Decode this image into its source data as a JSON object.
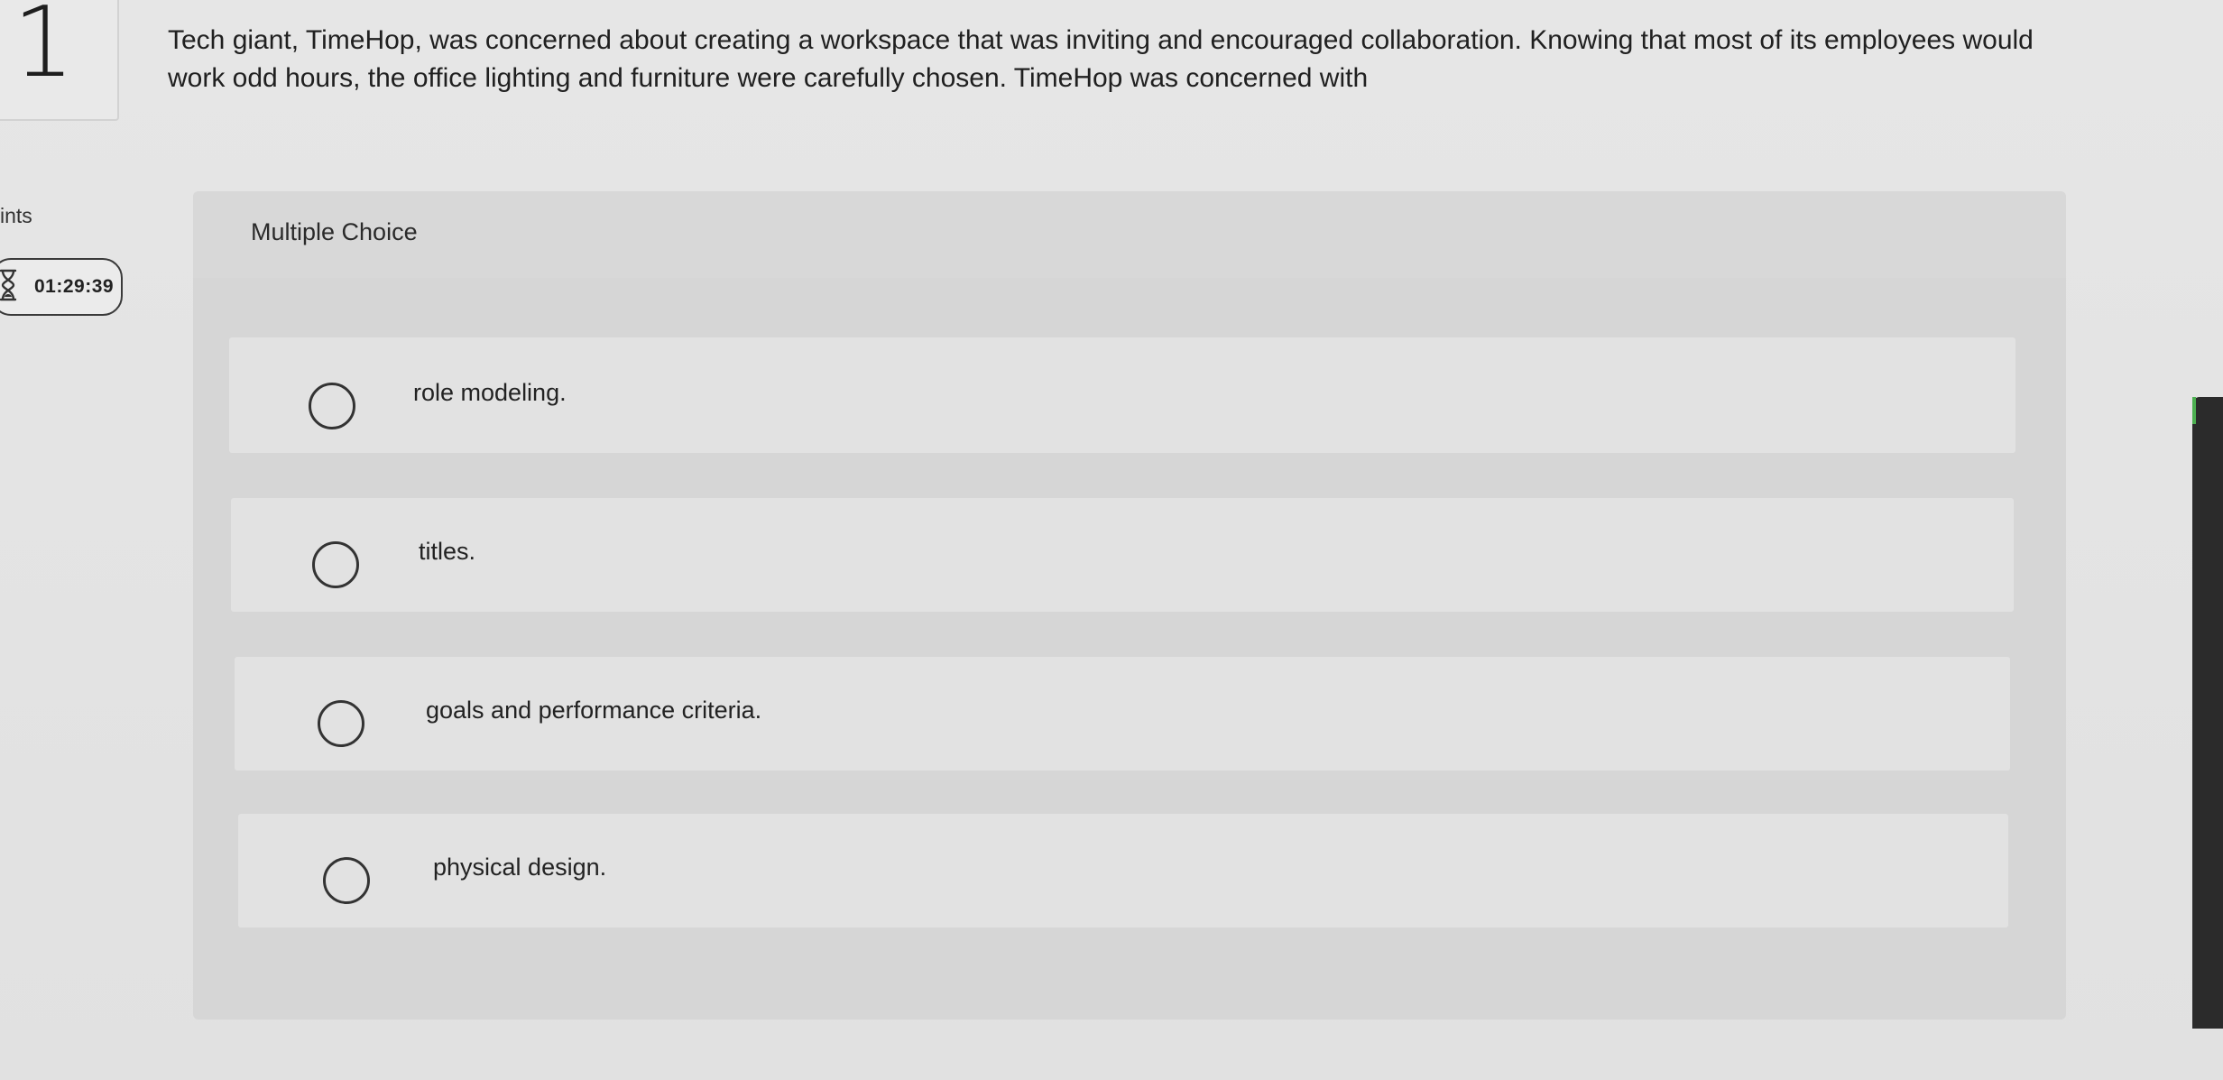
{
  "question": {
    "number": "1",
    "prompt": "Tech giant, TimeHop, was concerned about creating a workspace that was inviting and encouraged collaboration. Knowing that most of its employees would work odd hours, the office lighting and furniture were carefully chosen. TimeHop was concerned with"
  },
  "sidebar": {
    "points_label": "ints",
    "timer": {
      "icon": "hourglass-icon",
      "value": "01:29:39"
    }
  },
  "multiple_choice": {
    "label": "Multiple Choice",
    "options": [
      {
        "label": "role modeling.",
        "selected": false
      },
      {
        "label": "titles.",
        "selected": false
      },
      {
        "label": "goals and performance criteria.",
        "selected": false
      },
      {
        "label": "physical design.",
        "selected": false
      }
    ]
  },
  "colors": {
    "background": "#e4e4e4",
    "panel": "#d6d6d6",
    "option_row": "#e2e2e2",
    "text": "#222222"
  }
}
